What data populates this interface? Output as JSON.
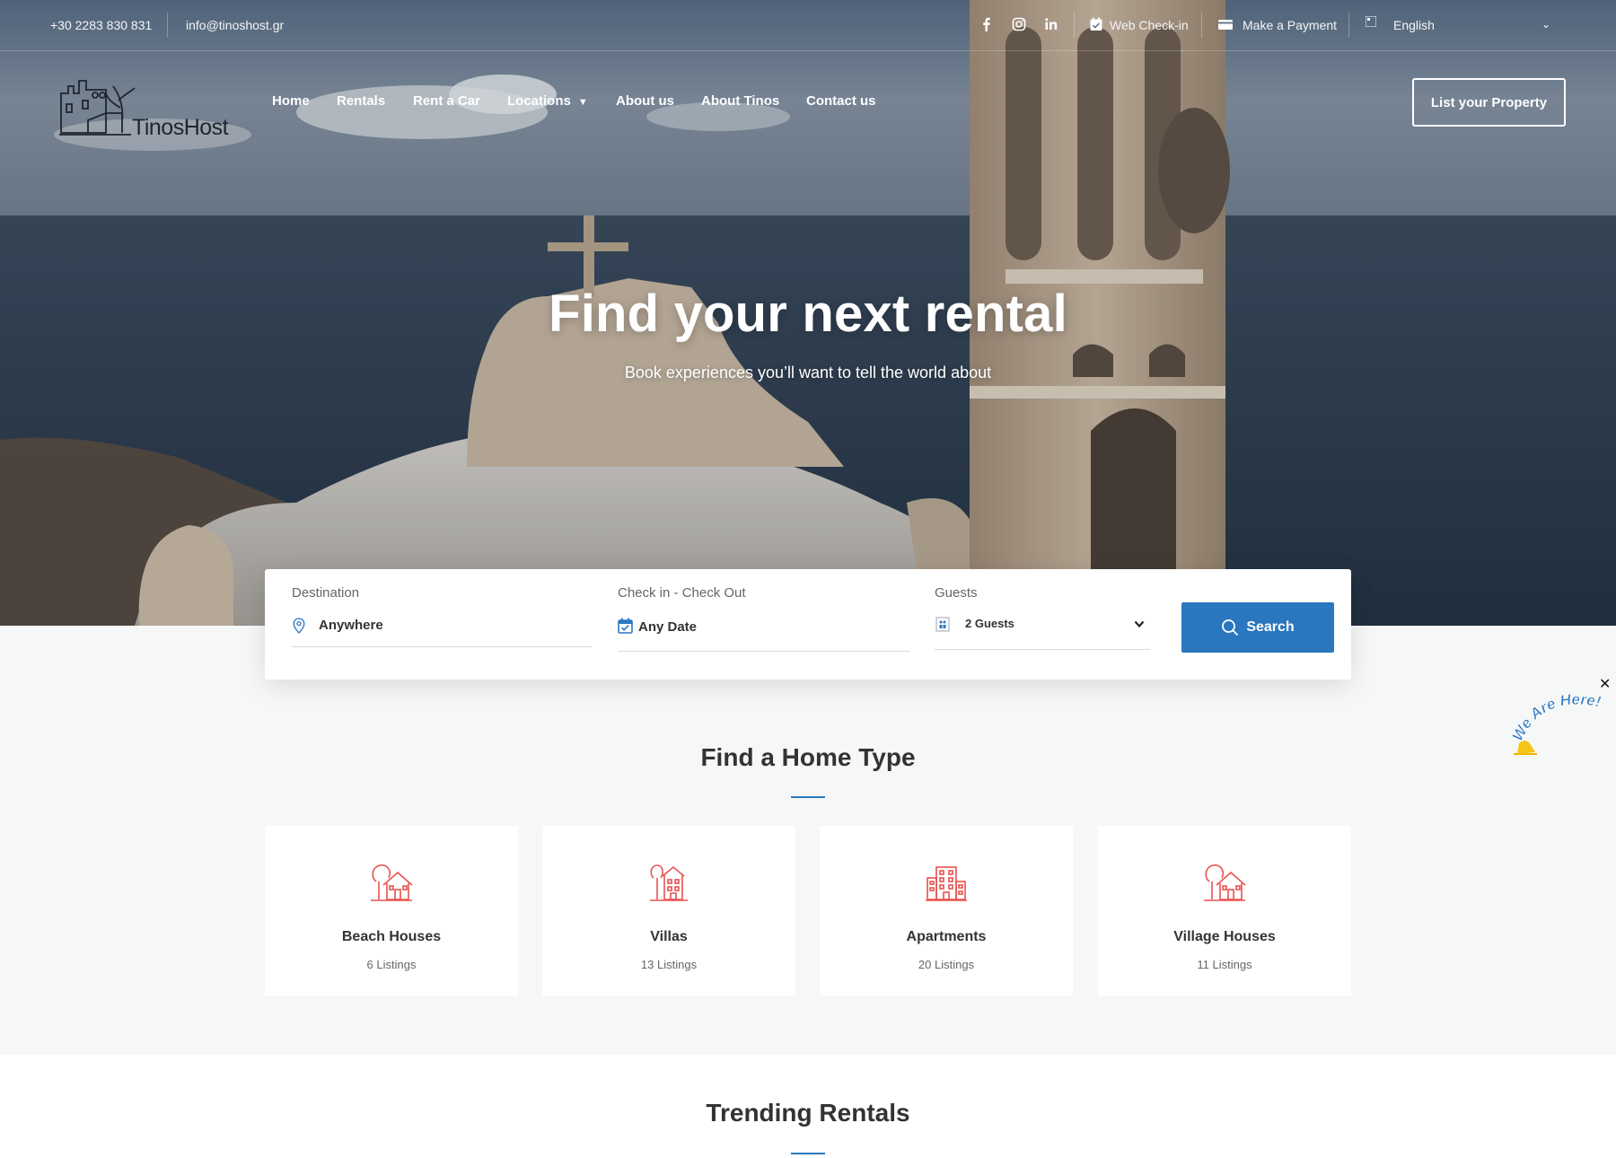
{
  "topbar": {
    "phone": "+30 2283 830 831",
    "email": "info@tinoshost.gr",
    "web_checkin": "Web Check-in",
    "make_payment": "Make a Payment",
    "language": "English"
  },
  "header": {
    "logo_text": "TinosHost",
    "nav": [
      "Home",
      "Rentals",
      "Rent a Car",
      "Locations",
      "About us",
      "About Tinos",
      "Contact us"
    ],
    "list_property": "List your Property"
  },
  "hero": {
    "title": "Find your next rental",
    "subtitle": "Book experiences you’ll want to tell the world about"
  },
  "search": {
    "destination_label": "Destination",
    "destination_value": "Anywhere",
    "dates_label": "Check in - Check Out",
    "dates_value": "Any Date",
    "guests_label": "Guests",
    "guests_value": "2 Guests",
    "button": "Search"
  },
  "home_types": {
    "title": "Find a Home Type",
    "items": [
      {
        "name": "Beach Houses",
        "count": "6 Listings",
        "icon": "house-tree-icon"
      },
      {
        "name": "Villas",
        "count": "13 Listings",
        "icon": "villa-icon"
      },
      {
        "name": "Apartments",
        "count": "20 Listings",
        "icon": "apartment-building-icon"
      },
      {
        "name": "Village Houses",
        "count": "11 Listings",
        "icon": "house-tree-icon"
      }
    ]
  },
  "trending": {
    "title": "Trending Rentals"
  },
  "badge": {
    "text": "We Are Here!"
  },
  "colors": {
    "accent": "#2a77bf",
    "icon": "#e8524f"
  }
}
